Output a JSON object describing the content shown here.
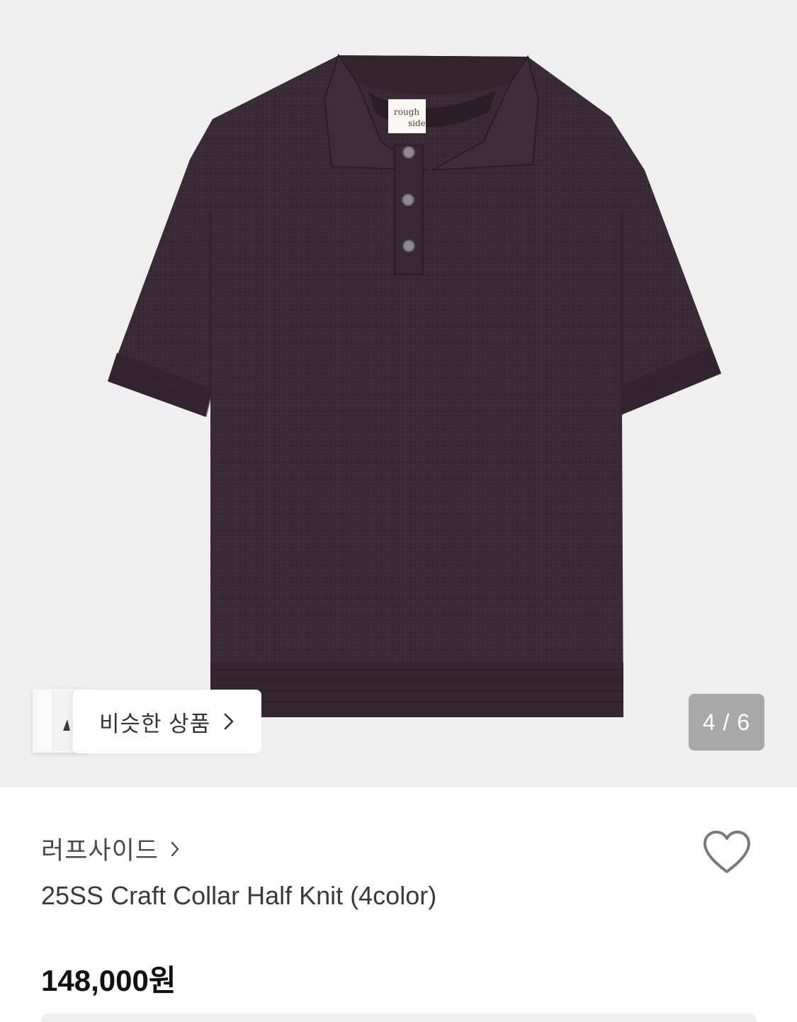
{
  "gallery": {
    "counter": "4 / 6",
    "similar_label": "비슷한 상품",
    "tag_line1": "rough",
    "tag_line2": "side"
  },
  "product": {
    "brand": "러프사이드",
    "name": "25SS Craft Collar Half Knit (4color)",
    "price": "148,000원"
  },
  "colors": {
    "image_bg": "#efefef",
    "shirt": "#3a2a35",
    "counter_bg": "#a8a8a8"
  },
  "icons": {
    "similar_chevron": "chevron-right-icon",
    "brand_chevron": "chevron-right-icon",
    "wishlist": "heart-outline-icon"
  }
}
